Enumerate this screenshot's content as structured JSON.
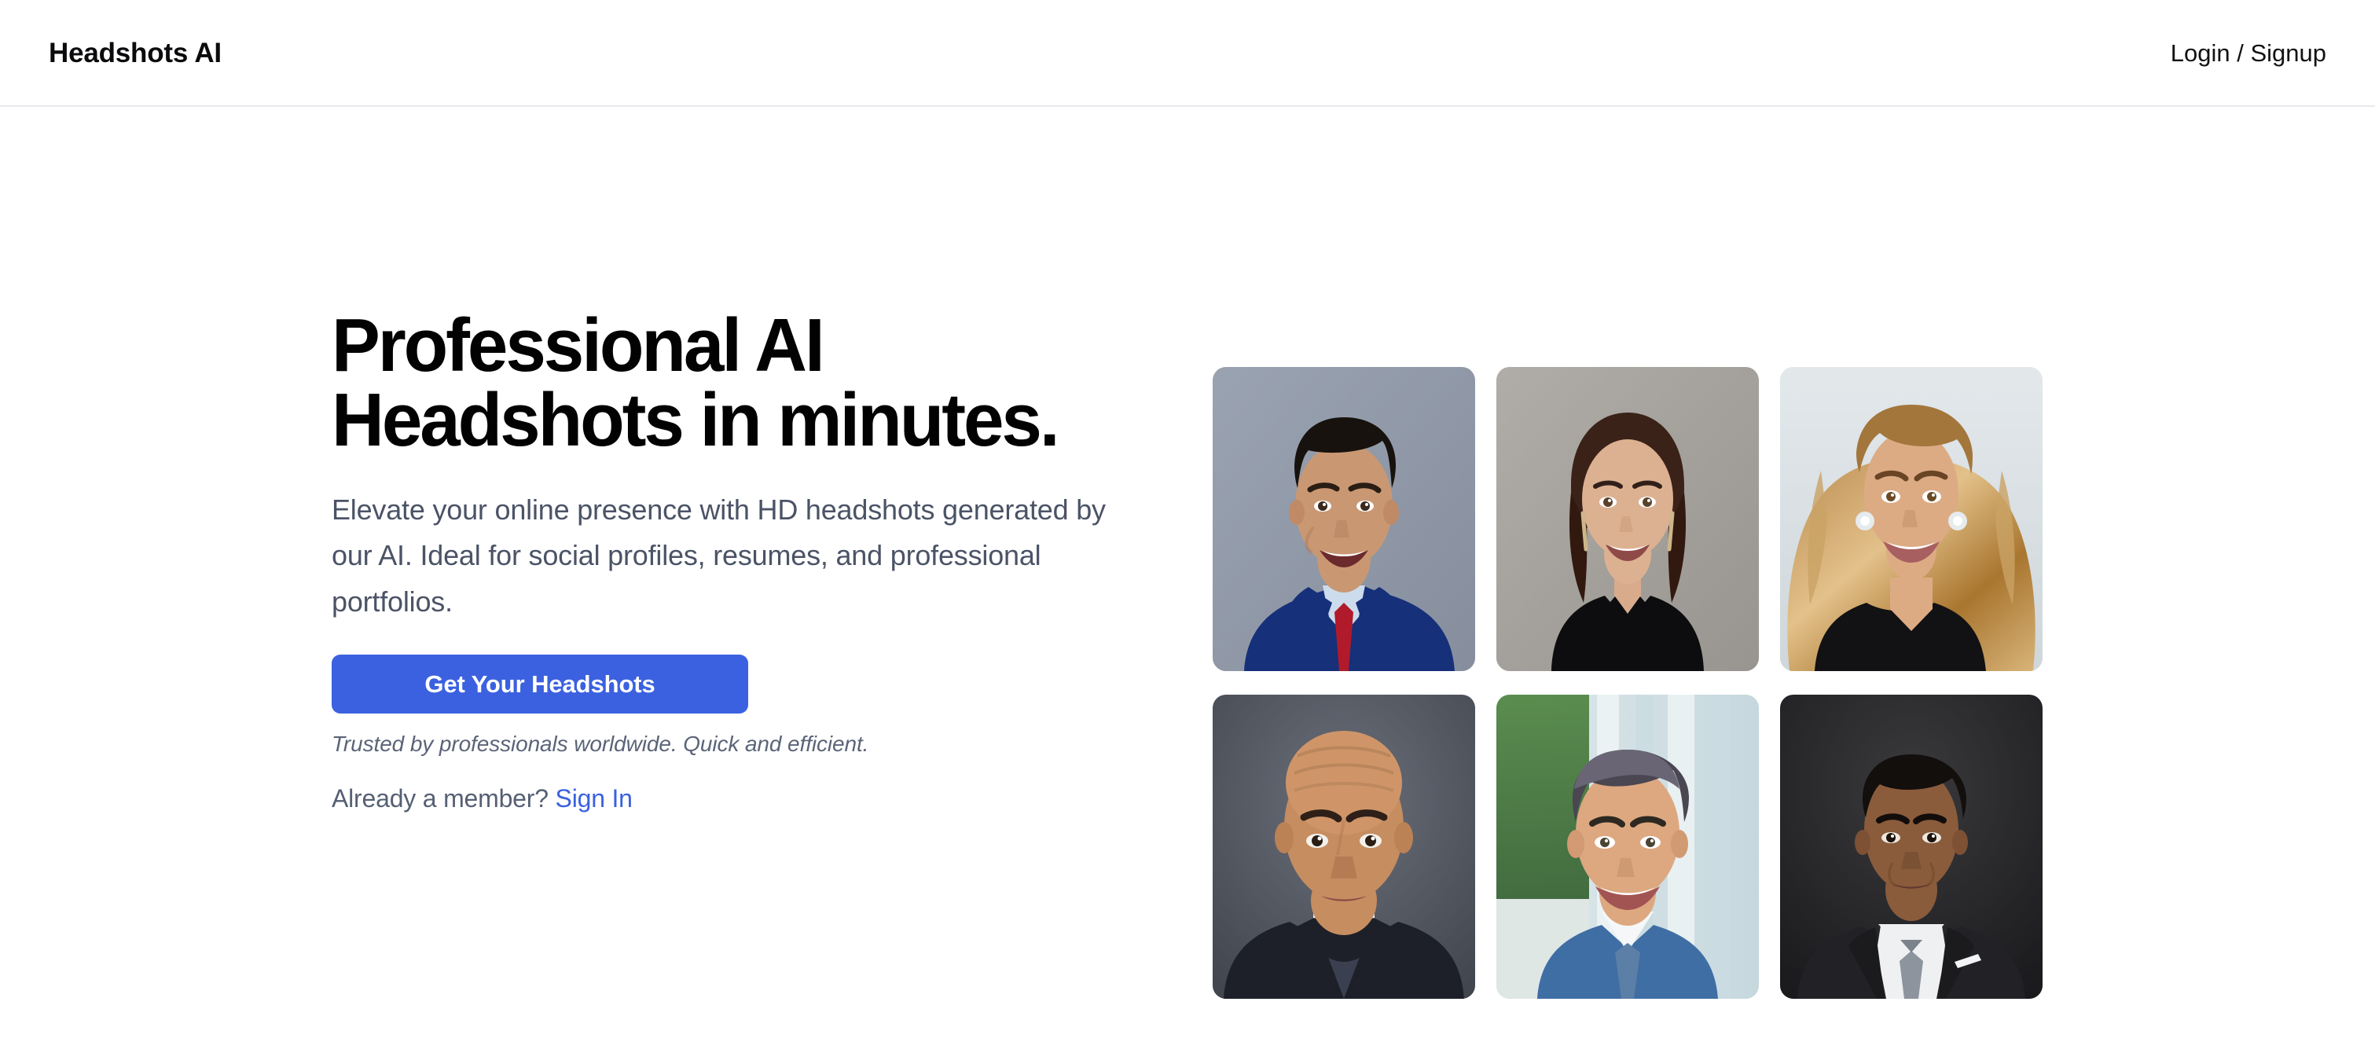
{
  "header": {
    "brand": "Headshots AI",
    "auth_label": "Login / Signup"
  },
  "hero": {
    "headline": "Professional AI\nHeadshots in minutes.",
    "subhead": "Elevate your online presence with HD headshots generated by our AI. Ideal for social profiles, resumes, and professional portfolios.",
    "cta_label": "Get Your Headshots",
    "trust_note": "Trusted by professionals worldwide. Quick and efficient.",
    "member_prompt": "Already a member?",
    "signin_label": "Sign In"
  },
  "colors": {
    "accent": "#3b61e0",
    "headline": "#020203",
    "body_text": "#4b5366",
    "muted_text": "#5b6478",
    "header_border": "#e8e9ee",
    "page_bg": "#ffffff"
  },
  "gallery": {
    "columns": 3,
    "rows": 2,
    "items": [
      {
        "id": "headshot-1",
        "alt": "Smiling man in navy suit with red tie on blue-gray background",
        "bg": "#98a0ae",
        "bg2": "#8d95a5",
        "skin": "#c99873",
        "skin_shadow": "#ad7c5c",
        "hair": "#18120e",
        "suit": "#16307a",
        "shirt": "#ccdced",
        "accent": "#b11a2b"
      },
      {
        "id": "headshot-2",
        "alt": "Smiling woman with long brown hair in black blazer on gray background",
        "bg": "#a9a6a2",
        "bg2": "#9d9a96",
        "skin": "#dcb191",
        "skin_shadow": "#bd9070",
        "hair": "#3a2218",
        "suit": "#0d0d0f",
        "shirt": "#1a1a1c",
        "accent": "#cdb68a"
      },
      {
        "id": "headshot-3",
        "alt": "Smiling woman with blonde wavy hair and diamond earrings in black top",
        "bg": "#dde3e6",
        "bg2": "#d3dade",
        "skin": "#dcab84",
        "skin_shadow": "#bd8a63",
        "hair": "#c8975a",
        "suit": "#121113",
        "shirt": "#1b1a1c",
        "accent": "#e6cfa4"
      },
      {
        "id": "headshot-4",
        "alt": "Bald man with serious expression in dark suit on dark gray background",
        "bg": "#5c6069",
        "bg2": "#494d56",
        "skin": "#c68d60",
        "skin_shadow": "#a06f47",
        "hair": "#3d2b1f",
        "suit": "#1d2028",
        "shirt": "#f1f2f4",
        "accent": "#2b2f38"
      },
      {
        "id": "headshot-5",
        "alt": "Young smiling man in blue suit outdoors with green foliage background",
        "bg": "#d8e4e8",
        "bg2": "#bcd2d8",
        "skin": "#dda880",
        "skin_shadow": "#bd8760",
        "hair": "#4a4652",
        "suit": "#3f6ea4",
        "shirt": "#f5f7f9",
        "accent": "#46713f"
      },
      {
        "id": "headshot-6",
        "alt": "Man in black suit with gray tie and pocket square on dark background",
        "bg": "#2a2a2c",
        "bg2": "#1b1b1d",
        "skin": "#8a5c3c",
        "skin_shadow": "#6b4329",
        "hair": "#130f0d",
        "suit": "#222226",
        "shirt": "#eef0f2",
        "accent": "#8d949d"
      }
    ]
  }
}
